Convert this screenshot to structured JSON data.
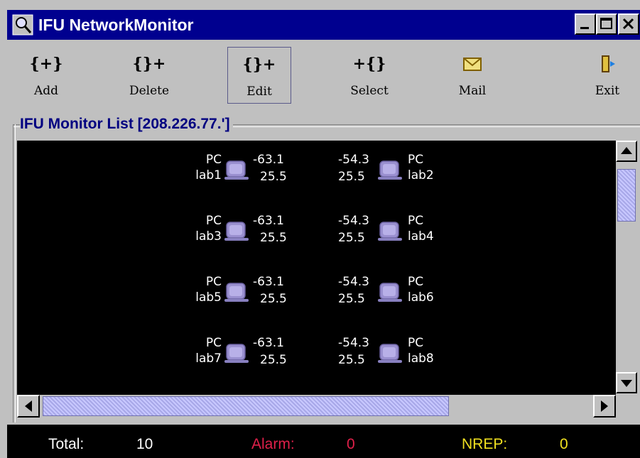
{
  "window": {
    "title": "IFU NetworkMonitor"
  },
  "toolbar": {
    "items": [
      {
        "label": "Add",
        "icon": "add-icon",
        "glyph": "{+}"
      },
      {
        "label": "Delete",
        "icon": "delete-icon",
        "glyph": "{}+"
      },
      {
        "label": "Edit",
        "icon": "edit-icon",
        "glyph": "{}+"
      },
      {
        "label": "Select",
        "icon": "select-icon",
        "glyph": "+{}"
      },
      {
        "label": "Mail",
        "icon": "mail-icon",
        "glyph": ""
      },
      {
        "label": "Exit",
        "icon": "exit-icon",
        "glyph": ""
      }
    ]
  },
  "monitor": {
    "group_title": "IFU Monitor List [208.226.77.']",
    "nodes": [
      {
        "type": "PC",
        "name": "lab1",
        "top": "-63.1",
        "bottom": "25.5"
      },
      {
        "type": "PC",
        "name": "lab2",
        "top": "-54.3",
        "bottom": "25.5"
      },
      {
        "type": "PC",
        "name": "lab3",
        "top": "-63.1",
        "bottom": "25.5"
      },
      {
        "type": "PC",
        "name": "lab4",
        "top": "-54.3",
        "bottom": "25.5"
      },
      {
        "type": "PC",
        "name": "lab5",
        "top": "-63.1",
        "bottom": "25.5"
      },
      {
        "type": "PC",
        "name": "lab6",
        "top": "-54.3",
        "bottom": "25.5"
      },
      {
        "type": "PC",
        "name": "lab7",
        "top": "-63.1",
        "bottom": "25.5"
      },
      {
        "type": "PC",
        "name": "lab8",
        "top": "-54.3",
        "bottom": "25.5"
      }
    ]
  },
  "status": {
    "total_label": "Total:",
    "total_value": "10",
    "alarm_label": "Alarm:",
    "alarm_value": "0",
    "nrep_label": "NREP:",
    "nrep_value": "0"
  },
  "colors": {
    "titlebar": "#00008f",
    "alarm": "#e0204a",
    "nrep": "#f0e020",
    "group_title": "#000080"
  }
}
